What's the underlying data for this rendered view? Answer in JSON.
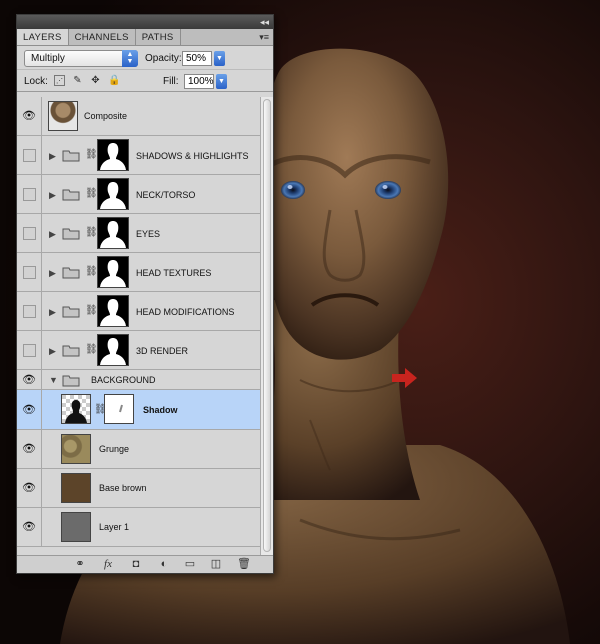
{
  "panel": {
    "tabs": [
      "LAYERS",
      "CHANNELS",
      "PATHS"
    ],
    "active_tab": "LAYERS"
  },
  "blend": {
    "mode": "Multiply",
    "opacity_label": "Opacity:",
    "opacity_value": "50%"
  },
  "lock": {
    "label": "Lock:",
    "fill_label": "Fill:",
    "fill_value": "100%"
  },
  "layers": [
    {
      "name": "Composite",
      "type": "layer",
      "visible": true
    },
    {
      "name": "SHADOWS & HIGHLIGHTS",
      "type": "group",
      "visible": false
    },
    {
      "name": "NECK/TORSO",
      "type": "group",
      "visible": false
    },
    {
      "name": "EYES",
      "type": "group",
      "visible": false
    },
    {
      "name": "HEAD TEXTURES",
      "type": "group",
      "visible": false
    },
    {
      "name": "HEAD MODIFICATIONS",
      "type": "group",
      "visible": false
    },
    {
      "name": "3D RENDER",
      "type": "group",
      "visible": false
    },
    {
      "name": "BACKGROUND",
      "type": "group-open",
      "visible": true
    },
    {
      "name": "Shadow",
      "type": "layer",
      "visible": true,
      "selected": true
    },
    {
      "name": "Grunge",
      "type": "layer",
      "visible": true
    },
    {
      "name": "Base brown",
      "type": "layer",
      "visible": true
    },
    {
      "name": "Layer 1",
      "type": "layer",
      "visible": true
    }
  ],
  "colors": {
    "selection": "#b8d4f8",
    "accent_blue": "#2a62c8",
    "base_brown": "#5c4429",
    "layer1_gray": "#6b6b6b",
    "arrow_red": "#c8241e"
  }
}
